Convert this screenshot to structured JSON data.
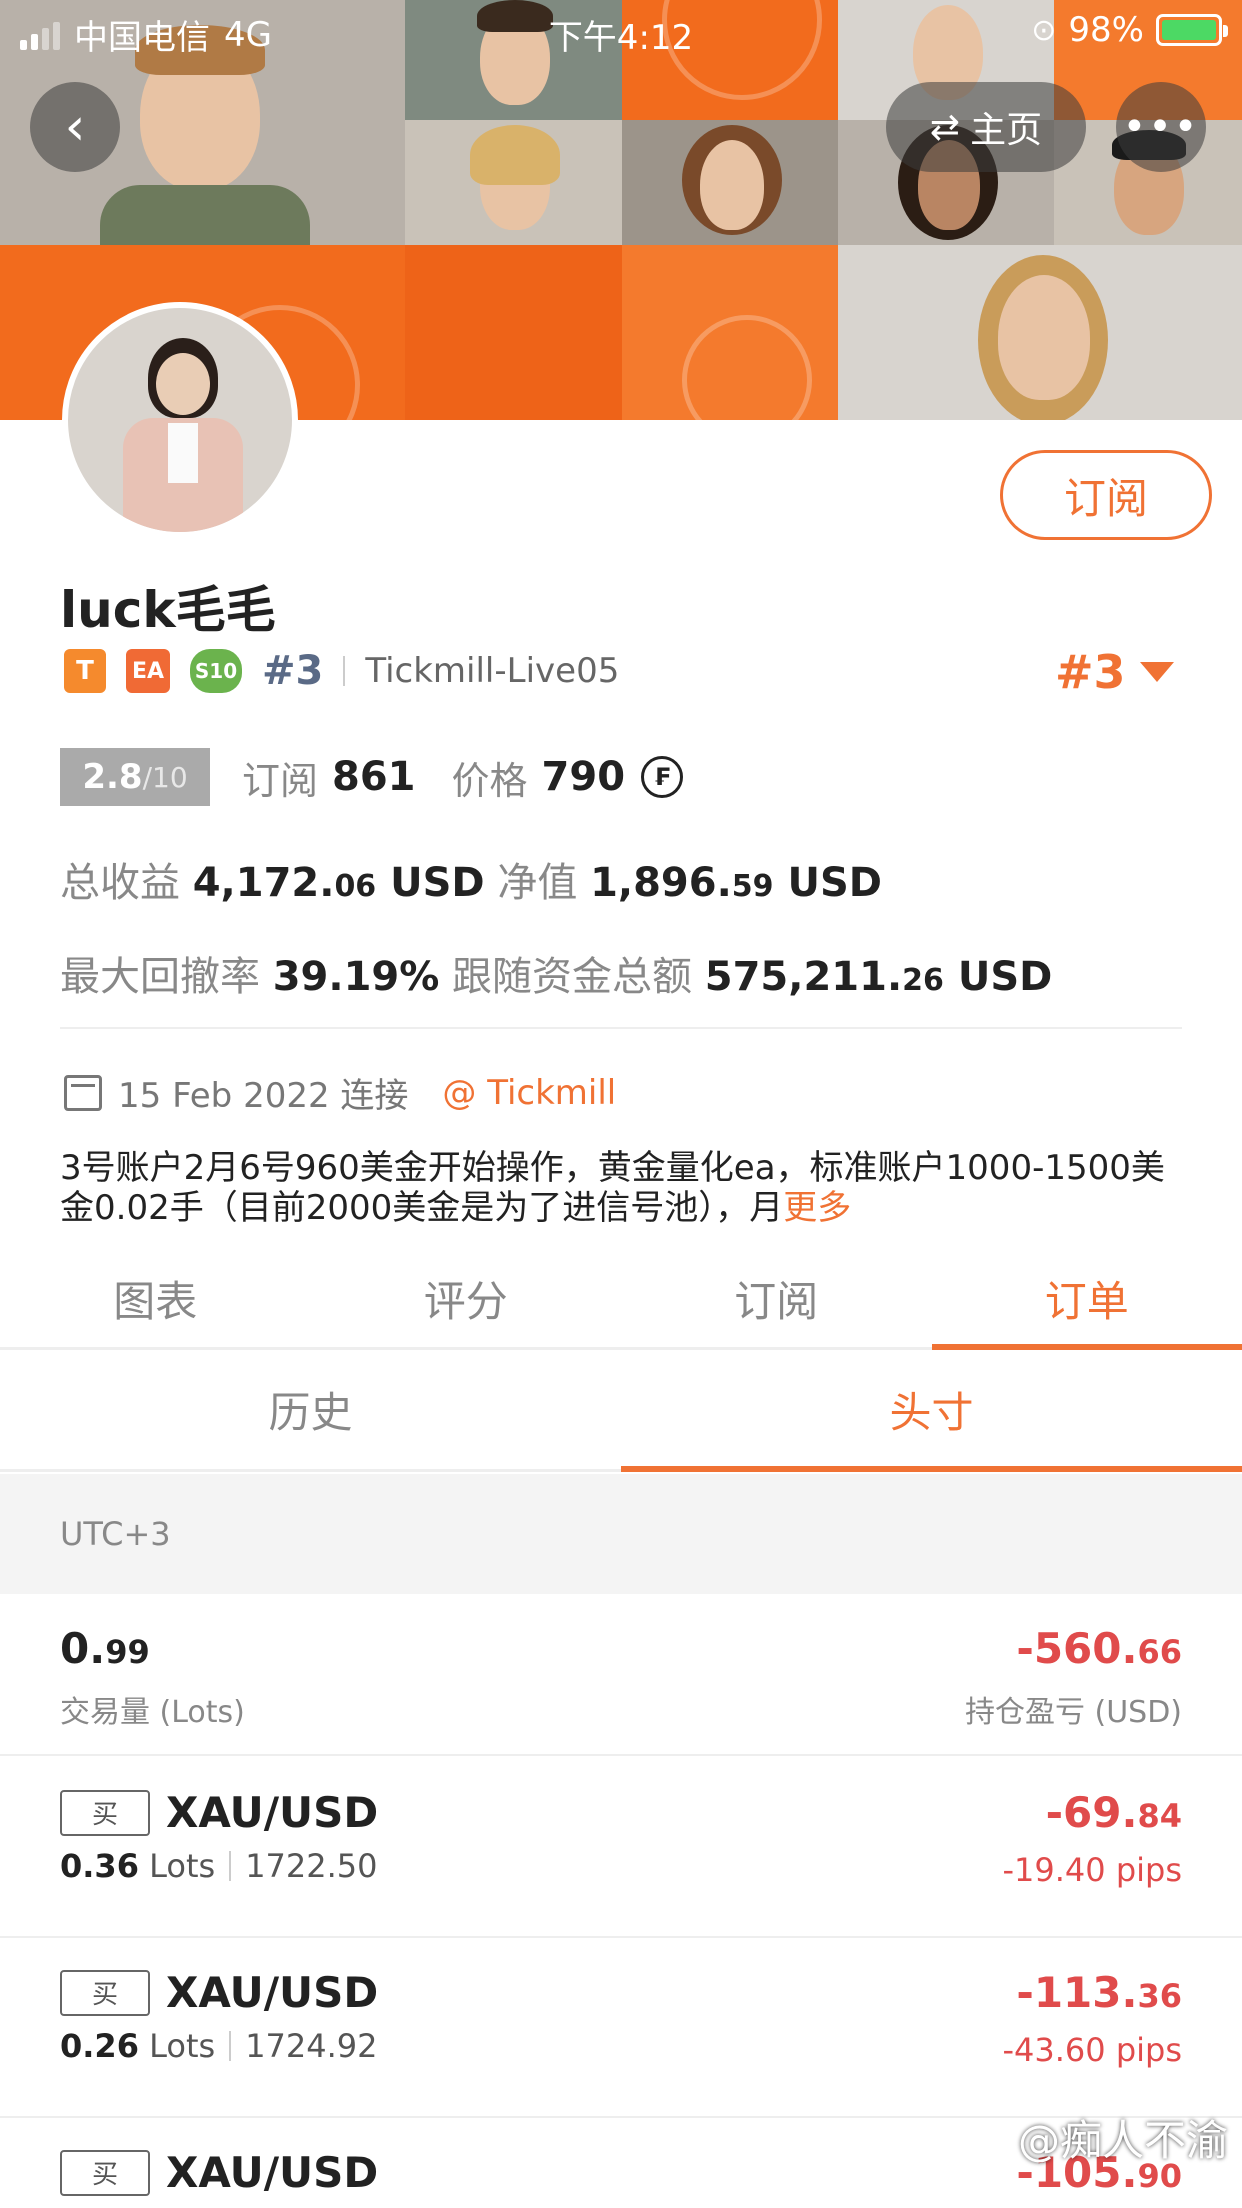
{
  "status_bar": {
    "carrier": "中国电信",
    "network": "4G",
    "time": "下午4:12",
    "battery": "98%"
  },
  "nav": {
    "back_icon": "chevron-left-icon",
    "home_label": "主页",
    "home_icon": "swap-arrows-icon",
    "more_icon": "ellipsis-icon"
  },
  "profile": {
    "username": "luck毛毛",
    "subscribe_label": "订阅",
    "badge_t": "T",
    "badge_ea": "EA",
    "badge_s10": "S10",
    "rank_small": "#3",
    "server": "Tickmill-Live05",
    "rank_big": "#3",
    "score": "2.8",
    "score_max": "/10",
    "subscribe_count_label": "订阅",
    "subscribe_count": "861",
    "price_label": "价格",
    "price": "790",
    "total_profit_label": "总收益",
    "total_profit_int": "4,172.",
    "total_profit_dec": "06",
    "total_profit_unit": "USD",
    "equity_label": "净值",
    "equity_int": "1,896.",
    "equity_dec": "59",
    "equity_unit": "USD",
    "max_drawdown_label": "最大回撤率",
    "max_drawdown": "39.19%",
    "follow_funds_label": "跟随资金总额",
    "follow_funds_int": "575,211.",
    "follow_funds_dec": "26",
    "follow_funds_unit": "USD",
    "connected_date": "15 Feb 2022 连接",
    "broker_link": "@ Tickmill",
    "description": "3号账户2月6号960美金开始操作，黄金量化ea，标准账户1000-1500美金0.02手（目前2000美金是为了进信号池），月",
    "more_label": "更多"
  },
  "tabs": {
    "chart": "图表",
    "rating": "评分",
    "subscription": "订阅",
    "orders": "订单"
  },
  "subtabs": {
    "history": "历史",
    "positions": "头寸"
  },
  "timezone": "UTC+3",
  "summary": {
    "volume_int": "0.",
    "volume_dec": "99",
    "volume_label": "交易量 (Lots)",
    "pnl_int": "-560.",
    "pnl_dec": "66",
    "pnl_label": "持仓盈亏 (USD)"
  },
  "orders": [
    {
      "side": "买",
      "symbol": "XAU/USD",
      "lots": "0.36",
      "lots_unit": "Lots",
      "price": "1722.50",
      "pnl_int": "-69.",
      "pnl_dec": "84",
      "pips": "-19.40 pips"
    },
    {
      "side": "买",
      "symbol": "XAU/USD",
      "lots": "0.26",
      "lots_unit": "Lots",
      "price": "1724.92",
      "pnl_int": "-113.",
      "pnl_dec": "36",
      "pips": "-43.60 pips"
    },
    {
      "side": "买",
      "symbol": "XAU/USD",
      "lots": "",
      "lots_unit": "",
      "price": "",
      "pnl_int": "-105.",
      "pnl_dec": "90",
      "pips": ""
    }
  ],
  "watermark": "@痴人不渝",
  "colors": {
    "accent": "#f07234",
    "loss": "#e04b4b",
    "banner_orange": "#f26b1d"
  }
}
